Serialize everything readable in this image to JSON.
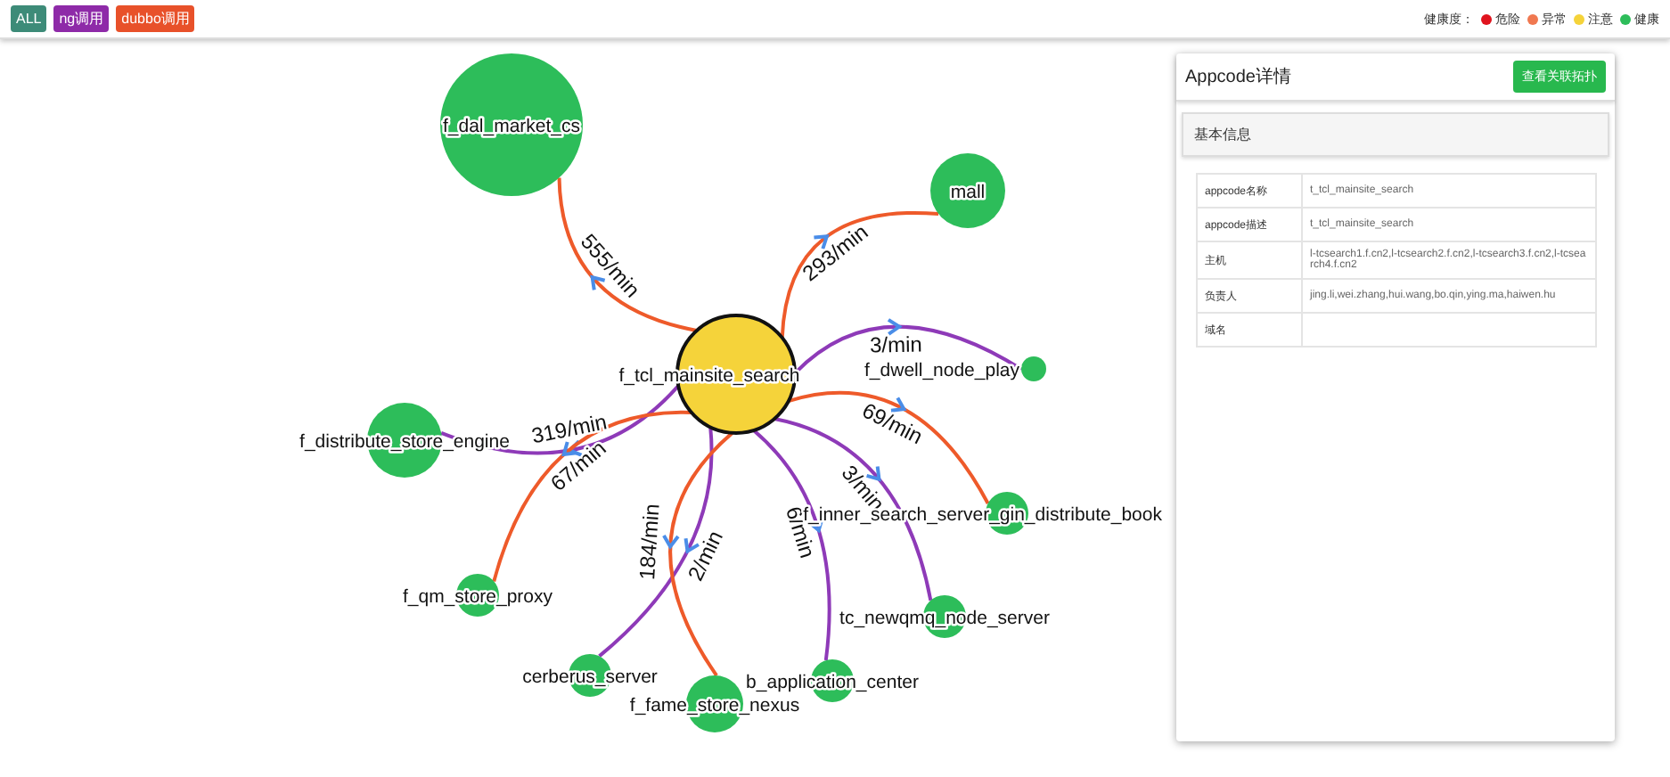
{
  "filters": [
    {
      "label": "ALL",
      "kind": "all"
    },
    {
      "label": "ng调用",
      "kind": "ng"
    },
    {
      "label": "dubbo调用",
      "kind": "dubbo"
    }
  ],
  "legend": {
    "title": "健康度：",
    "items": [
      {
        "label": "危险",
        "color": "#e0141e"
      },
      {
        "label": "异常",
        "color": "#f07850"
      },
      {
        "label": "注意",
        "color": "#f5d33a"
      },
      {
        "label": "健康",
        "color": "#2dbd5a"
      }
    ]
  },
  "graph": {
    "center": {
      "label": "f_tcl_mainsite_search",
      "color": "#f5d33a"
    },
    "nodes": [
      {
        "label": "f_dal_market_cs",
        "color": "#2dbd5a",
        "edge": {
          "kind": "ng",
          "rate": "555/min"
        }
      },
      {
        "label": "mall",
        "color": "#2dbd5a",
        "edge": {
          "kind": "ng",
          "rate": "293/min"
        }
      },
      {
        "label": "f_dwell_node_play",
        "color": "#2dbd5a",
        "edge": {
          "kind": "dubbo",
          "rate": "3/min"
        }
      },
      {
        "label": "f_distribute_store_engine",
        "color": "#2dbd5a",
        "edge": {
          "kind": "dubbo",
          "rate": "319/min"
        }
      },
      {
        "label": "f_inner_search_server_gin_distribute_book",
        "color": "#2dbd5a",
        "edge": {
          "kind": "ng",
          "rate": "69/min"
        }
      },
      {
        "label": "f_qm_store_proxy",
        "color": "#2dbd5a",
        "edge": {
          "kind": "ng",
          "rate": "67/min"
        }
      },
      {
        "label": "tc_newqmq_node_server",
        "color": "#2dbd5a",
        "edge": {
          "kind": "dubbo",
          "rate": "3/min"
        }
      },
      {
        "label": "cerberus_server",
        "color": "#2dbd5a",
        "edge": {
          "kind": "dubbo",
          "rate": "2/min"
        }
      },
      {
        "label": "f_fame_store_nexus",
        "color": "#2dbd5a",
        "edge": {
          "kind": "ng",
          "rate": "184/min"
        }
      },
      {
        "label": "b_application_center",
        "color": "#2dbd5a",
        "edge": {
          "kind": "dubbo",
          "rate": "6/min"
        }
      }
    ]
  },
  "panel": {
    "title": "Appcode详情",
    "button": "查看关联拓扑",
    "section": "基本信息",
    "rows": [
      {
        "label": "appcode名称",
        "value": "t_tcl_mainsite_search"
      },
      {
        "label": "appcode描述",
        "value": "t_tcl_mainsite_search"
      },
      {
        "label": "主机",
        "value": "l-tcsearch1.f.cn2,l-tcsearch2.f.cn2,l-tcsearch3.f.cn2,l-tcsearch4.f.cn2"
      },
      {
        "label": "负责人",
        "value": "jing.li,wei.zhang,hui.wang,bo.qin,ying.ma,haiwen.hu"
      },
      {
        "label": "域名",
        "value": ""
      }
    ]
  }
}
